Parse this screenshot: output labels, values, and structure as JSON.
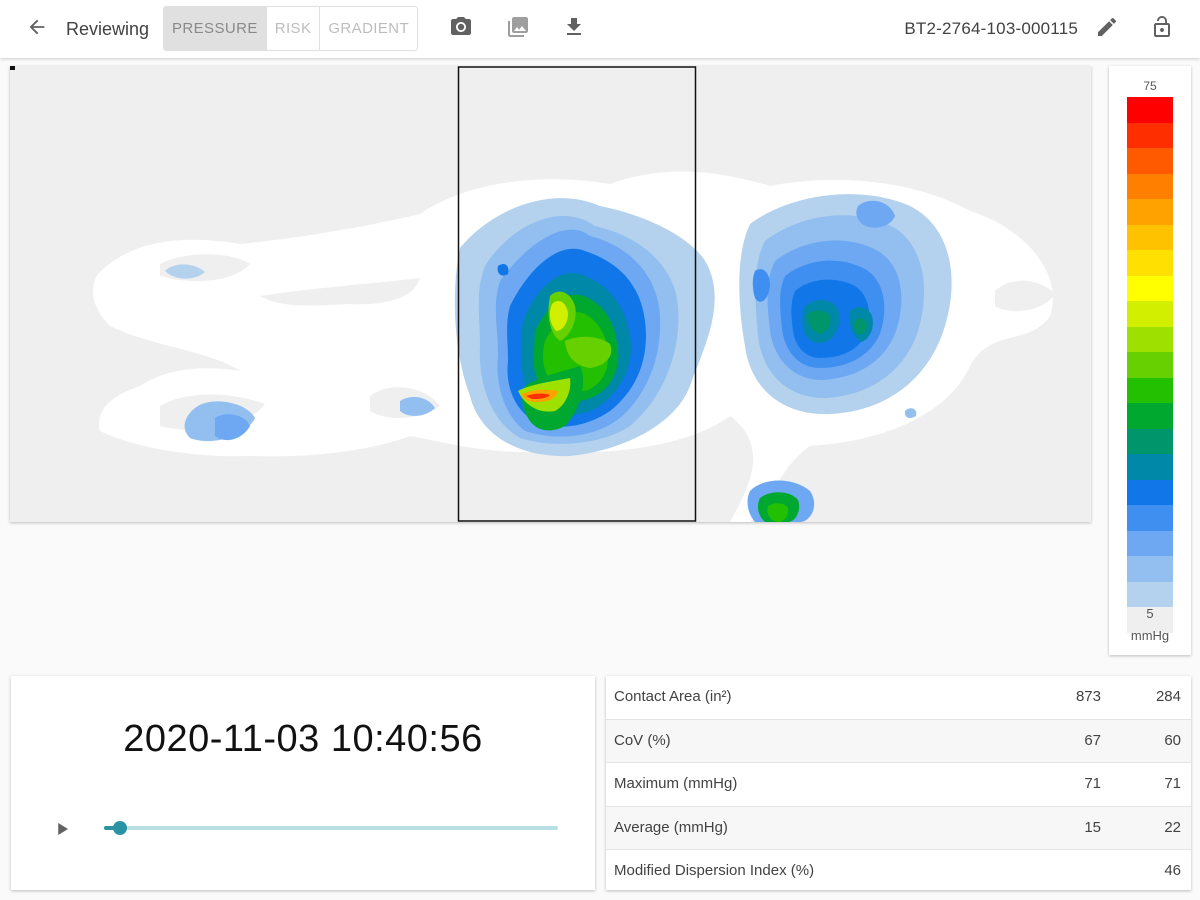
{
  "toolbar": {
    "title": "Reviewing",
    "modes": [
      {
        "label": "PRESSURE",
        "active": true
      },
      {
        "label": "RISK",
        "active": false
      },
      {
        "label": "GRADIENT",
        "active": false
      }
    ],
    "device_id": "BT2-2764-103-000115",
    "icons": [
      "arrow-back-icon",
      "camera-icon",
      "image-icon",
      "download-icon",
      "pencil-icon",
      "lock-open-icon"
    ]
  },
  "legend": {
    "max_label": "75",
    "min_label": "5",
    "unit": "mmHg",
    "colors": [
      "#ff0000",
      "#ff2e00",
      "#ff5a00",
      "#ff8000",
      "#ffa200",
      "#ffc200",
      "#ffe000",
      "#ffff00",
      "#d2ef00",
      "#9ee000",
      "#66d000",
      "#22c000",
      "#00a830",
      "#00956a",
      "#0088a8",
      "#1177e8",
      "#3f8ff0",
      "#6ea8f2",
      "#92bff0",
      "#b4d2ee",
      "#efefef"
    ]
  },
  "playback": {
    "timestamp": "2020-11-03 10:40:56",
    "progress": 0.035,
    "play_icon": "play-icon"
  },
  "stats": {
    "rows": [
      {
        "label": "Contact Area (in²)",
        "v1": "873",
        "v2": "284"
      },
      {
        "label": "CoV (%)",
        "v1": "67",
        "v2": "60"
      },
      {
        "label": "Maximum (mmHg)",
        "v1": "71",
        "v2": "71"
      },
      {
        "label": "Average (mmHg)",
        "v1": "15",
        "v2": "22"
      },
      {
        "label": "Modified Dispersion Index (%)",
        "v1": "",
        "v2": "46"
      }
    ]
  }
}
